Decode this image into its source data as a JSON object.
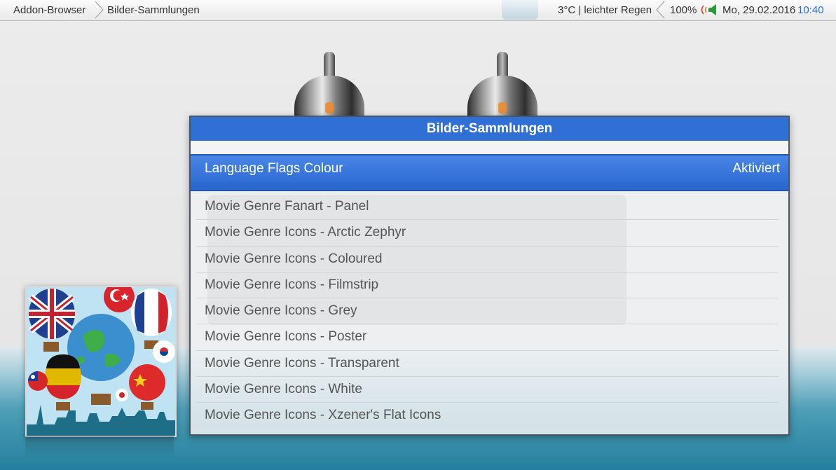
{
  "header": {
    "breadcrumb": [
      "Addon-Browser",
      "Bilder-Sammlungen"
    ],
    "weather": "3°C | leichter Regen",
    "volume": "100%",
    "date": "Mo, 29.02.2016",
    "time": "10:40"
  },
  "dialog": {
    "title": "Bilder-Sammlungen",
    "selected": {
      "label": "Language Flags Colour",
      "status": "Aktiviert"
    },
    "items": [
      "Movie Genre Fanart - Panel",
      "Movie Genre Icons - Arctic Zephyr",
      "Movie Genre Icons - Coloured",
      "Movie Genre Icons - Filmstrip",
      "Movie Genre Icons - Grey",
      "Movie Genre Icons - Poster",
      "Movie Genre Icons - Transparent",
      "Movie Genre Icons - White",
      "Movie Genre Icons - Xzener's Flat Icons"
    ]
  },
  "colors": {
    "accent": "#2f6fd6",
    "clock": "#2a6fd4"
  },
  "icons": [
    "volume-icon",
    "chevron-icon",
    "language-flags-thumbnail"
  ]
}
